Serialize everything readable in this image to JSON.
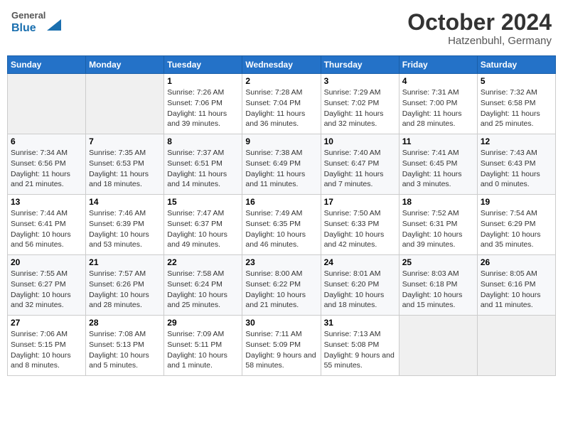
{
  "header": {
    "logo_general": "General",
    "logo_blue": "Blue",
    "month_year": "October 2024",
    "location": "Hatzenbuhl, Germany"
  },
  "days_of_week": [
    "Sunday",
    "Monday",
    "Tuesday",
    "Wednesday",
    "Thursday",
    "Friday",
    "Saturday"
  ],
  "weeks": [
    [
      {
        "day": "",
        "content": ""
      },
      {
        "day": "",
        "content": ""
      },
      {
        "day": "1",
        "content": "Sunrise: 7:26 AM\nSunset: 7:06 PM\nDaylight: 11 hours and 39 minutes."
      },
      {
        "day": "2",
        "content": "Sunrise: 7:28 AM\nSunset: 7:04 PM\nDaylight: 11 hours and 36 minutes."
      },
      {
        "day": "3",
        "content": "Sunrise: 7:29 AM\nSunset: 7:02 PM\nDaylight: 11 hours and 32 minutes."
      },
      {
        "day": "4",
        "content": "Sunrise: 7:31 AM\nSunset: 7:00 PM\nDaylight: 11 hours and 28 minutes."
      },
      {
        "day": "5",
        "content": "Sunrise: 7:32 AM\nSunset: 6:58 PM\nDaylight: 11 hours and 25 minutes."
      }
    ],
    [
      {
        "day": "6",
        "content": "Sunrise: 7:34 AM\nSunset: 6:56 PM\nDaylight: 11 hours and 21 minutes."
      },
      {
        "day": "7",
        "content": "Sunrise: 7:35 AM\nSunset: 6:53 PM\nDaylight: 11 hours and 18 minutes."
      },
      {
        "day": "8",
        "content": "Sunrise: 7:37 AM\nSunset: 6:51 PM\nDaylight: 11 hours and 14 minutes."
      },
      {
        "day": "9",
        "content": "Sunrise: 7:38 AM\nSunset: 6:49 PM\nDaylight: 11 hours and 11 minutes."
      },
      {
        "day": "10",
        "content": "Sunrise: 7:40 AM\nSunset: 6:47 PM\nDaylight: 11 hours and 7 minutes."
      },
      {
        "day": "11",
        "content": "Sunrise: 7:41 AM\nSunset: 6:45 PM\nDaylight: 11 hours and 3 minutes."
      },
      {
        "day": "12",
        "content": "Sunrise: 7:43 AM\nSunset: 6:43 PM\nDaylight: 11 hours and 0 minutes."
      }
    ],
    [
      {
        "day": "13",
        "content": "Sunrise: 7:44 AM\nSunset: 6:41 PM\nDaylight: 10 hours and 56 minutes."
      },
      {
        "day": "14",
        "content": "Sunrise: 7:46 AM\nSunset: 6:39 PM\nDaylight: 10 hours and 53 minutes."
      },
      {
        "day": "15",
        "content": "Sunrise: 7:47 AM\nSunset: 6:37 PM\nDaylight: 10 hours and 49 minutes."
      },
      {
        "day": "16",
        "content": "Sunrise: 7:49 AM\nSunset: 6:35 PM\nDaylight: 10 hours and 46 minutes."
      },
      {
        "day": "17",
        "content": "Sunrise: 7:50 AM\nSunset: 6:33 PM\nDaylight: 10 hours and 42 minutes."
      },
      {
        "day": "18",
        "content": "Sunrise: 7:52 AM\nSunset: 6:31 PM\nDaylight: 10 hours and 39 minutes."
      },
      {
        "day": "19",
        "content": "Sunrise: 7:54 AM\nSunset: 6:29 PM\nDaylight: 10 hours and 35 minutes."
      }
    ],
    [
      {
        "day": "20",
        "content": "Sunrise: 7:55 AM\nSunset: 6:27 PM\nDaylight: 10 hours and 32 minutes."
      },
      {
        "day": "21",
        "content": "Sunrise: 7:57 AM\nSunset: 6:26 PM\nDaylight: 10 hours and 28 minutes."
      },
      {
        "day": "22",
        "content": "Sunrise: 7:58 AM\nSunset: 6:24 PM\nDaylight: 10 hours and 25 minutes."
      },
      {
        "day": "23",
        "content": "Sunrise: 8:00 AM\nSunset: 6:22 PM\nDaylight: 10 hours and 21 minutes."
      },
      {
        "day": "24",
        "content": "Sunrise: 8:01 AM\nSunset: 6:20 PM\nDaylight: 10 hours and 18 minutes."
      },
      {
        "day": "25",
        "content": "Sunrise: 8:03 AM\nSunset: 6:18 PM\nDaylight: 10 hours and 15 minutes."
      },
      {
        "day": "26",
        "content": "Sunrise: 8:05 AM\nSunset: 6:16 PM\nDaylight: 10 hours and 11 minutes."
      }
    ],
    [
      {
        "day": "27",
        "content": "Sunrise: 7:06 AM\nSunset: 5:15 PM\nDaylight: 10 hours and 8 minutes."
      },
      {
        "day": "28",
        "content": "Sunrise: 7:08 AM\nSunset: 5:13 PM\nDaylight: 10 hours and 5 minutes."
      },
      {
        "day": "29",
        "content": "Sunrise: 7:09 AM\nSunset: 5:11 PM\nDaylight: 10 hours and 1 minute."
      },
      {
        "day": "30",
        "content": "Sunrise: 7:11 AM\nSunset: 5:09 PM\nDaylight: 9 hours and 58 minutes."
      },
      {
        "day": "31",
        "content": "Sunrise: 7:13 AM\nSunset: 5:08 PM\nDaylight: 9 hours and 55 minutes."
      },
      {
        "day": "",
        "content": ""
      },
      {
        "day": "",
        "content": ""
      }
    ]
  ]
}
